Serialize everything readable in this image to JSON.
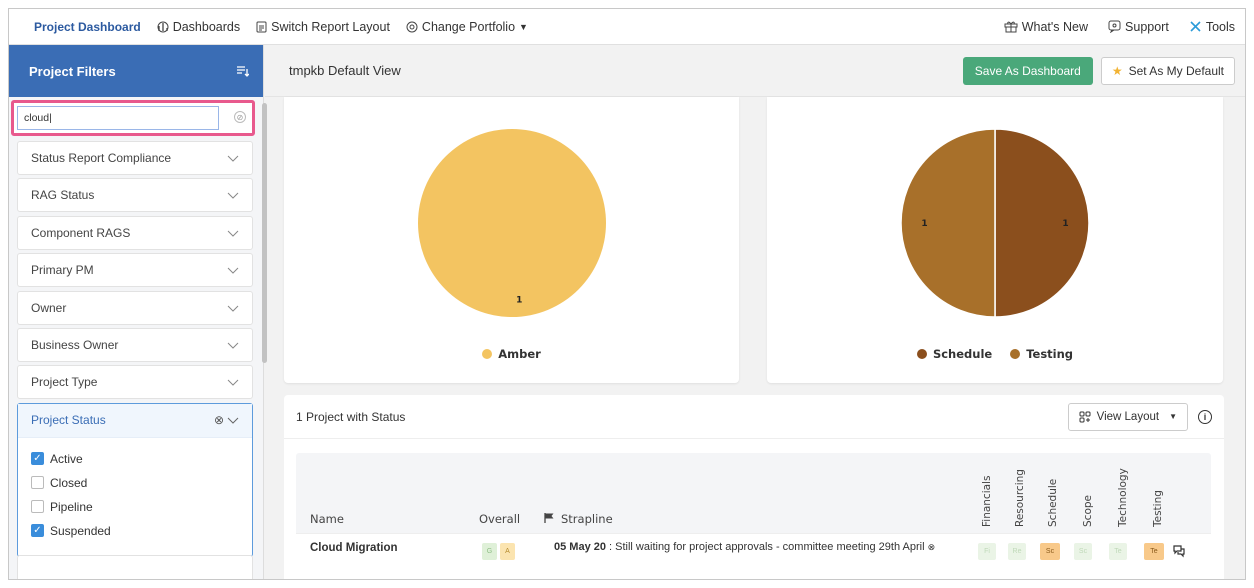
{
  "nav": {
    "brand": "Project Dashboard",
    "dashboards": "Dashboards",
    "switch_layout": "Switch Report Layout",
    "change_portfolio": "Change Portfolio",
    "whats_new": "What's New",
    "support": "Support",
    "tools": "Tools"
  },
  "sidebar": {
    "title": "Project Filters",
    "search_value": "cloud|",
    "filters": [
      "Status Report Compliance",
      "RAG Status",
      "Component RAGS",
      "Primary PM",
      "Owner",
      "Business Owner",
      "Project Type"
    ],
    "open_filter": {
      "label": "Project Status",
      "options": [
        {
          "label": "Active",
          "checked": true
        },
        {
          "label": "Closed",
          "checked": false
        },
        {
          "label": "Pipeline",
          "checked": false
        },
        {
          "label": "Suspended",
          "checked": true
        }
      ]
    }
  },
  "main": {
    "view_title": "tmpkb Default View",
    "save_btn": "Save As Dashboard",
    "default_btn": "Set As My Default"
  },
  "chart_data": [
    {
      "type": "pie",
      "categories": [
        "Amber"
      ],
      "values": [
        1
      ],
      "colors": [
        "#f3c461"
      ],
      "legend": "bottom"
    },
    {
      "type": "pie",
      "categories": [
        "Schedule",
        "Testing"
      ],
      "values": [
        1,
        1
      ],
      "colors": [
        "#8b4f1d",
        "#a8702a"
      ],
      "legend": "bottom"
    }
  ],
  "table": {
    "title": "1 Project with Status",
    "view_layout": "View Layout",
    "headers": {
      "name": "Name",
      "overall": "Overall",
      "strapline": "Strapline",
      "components": [
        "Financials",
        "Resourcing",
        "Schedule",
        "Scope",
        "Technology",
        "Testing"
      ]
    },
    "rows": [
      {
        "name": "Cloud Migration",
        "overall": [
          "G",
          "A"
        ],
        "strap_date": "05 May 20",
        "strap_text": " : Still waiting for project approvals - committee meeting 29th April",
        "components": [
          "Fi",
          "Re",
          "Sc",
          "Sc",
          "Te",
          "Te"
        ]
      }
    ]
  },
  "colors": {
    "header_blue": "#3a6db5",
    "save_green": "#4aa87a",
    "highlight": "#e8598d",
    "amber": "#f3c461"
  }
}
